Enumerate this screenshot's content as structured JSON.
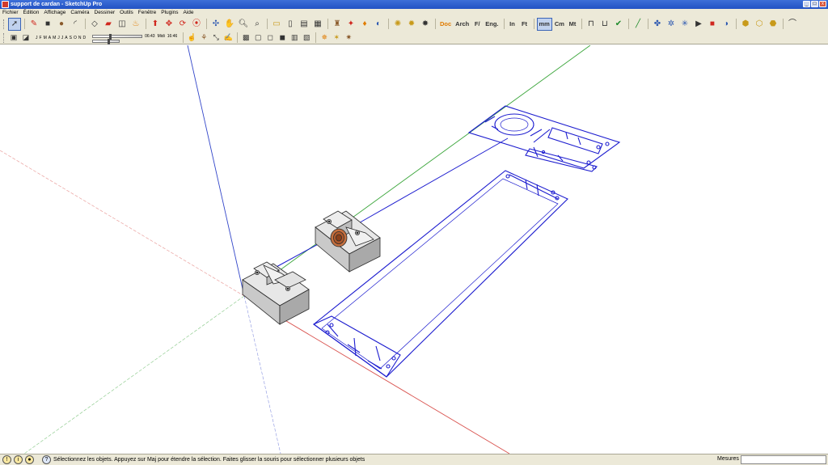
{
  "window": {
    "title": "support de cardan - SketchUp Pro",
    "minimize": "_",
    "maximize": "□",
    "close": "x"
  },
  "menu": [
    "Fichier",
    "Édition",
    "Affichage",
    "Caméra",
    "Dessiner",
    "Outils",
    "Fenêtre",
    "Plugins",
    "Aide"
  ],
  "toolbar_text": {
    "doc": "Doc",
    "arch": "Arch",
    "fraction": "F/",
    "eng": "Eng.",
    "inch": "In",
    "feet": "Ft",
    "mm": "mm",
    "cm": "Cm",
    "mt": "Mt"
  },
  "shadow": {
    "months": [
      "J",
      "F",
      "M",
      "A",
      "M",
      "J",
      "J",
      "A",
      "S",
      "O",
      "N",
      "D"
    ],
    "time_start": "06:43",
    "time_mid": "Midi",
    "time_end": "16:46",
    "month_position": 0.33,
    "time_position": 0.55
  },
  "status": {
    "message": "Sélectionnez les objets. Appuyez sur Maj pour étendre la sélection. Faites glisser la souris pour sélectionner plusieurs objets",
    "measure_label": "Mesures",
    "measure_value": ""
  },
  "colors": {
    "axis_red": "#d9534f",
    "axis_green": "#3aa53a",
    "axis_blue": "#3346c9",
    "drawing_lines": "#1c1ccf",
    "bearing_center": "#b0582a"
  }
}
